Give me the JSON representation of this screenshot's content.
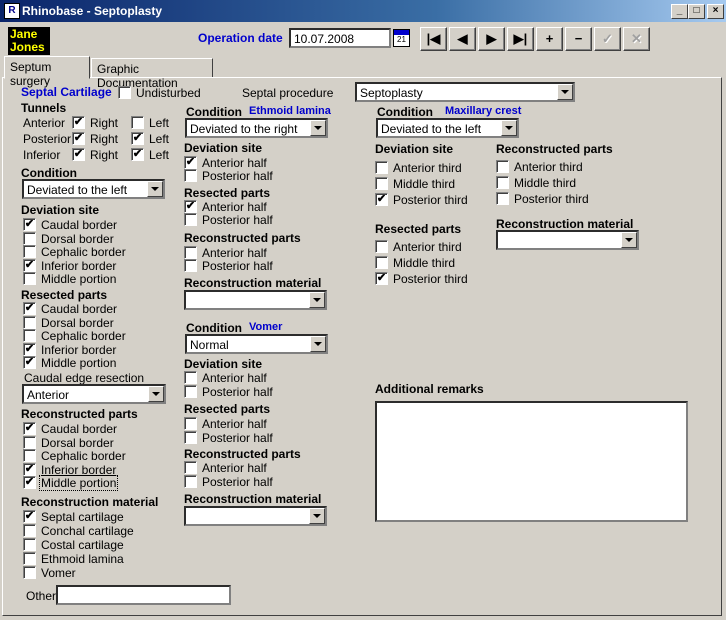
{
  "window": {
    "title": "Rhinobase - Septoplasty",
    "controls": [
      "_",
      "□",
      "×"
    ]
  },
  "patient": {
    "first": "Jane",
    "last": "Jones"
  },
  "operation": {
    "label": "Operation date",
    "date": "10.07.2008"
  },
  "tabs": [
    "Septum surgery",
    "Graphic Documentation"
  ],
  "septal": {
    "title": "Septal Cartilage",
    "undisturbed": "Undisturbed",
    "procedure_label": "Septal procedure",
    "procedure_value": "Septoplasty",
    "tunnels": {
      "title": "Tunnels",
      "rows": [
        "Anterior",
        "Posterior",
        "Inferior"
      ],
      "right": "Right",
      "left": "Left"
    },
    "condition": {
      "title": "Condition",
      "value": "Deviated to the left"
    },
    "deviation": {
      "title": "Deviation site",
      "items": [
        "Caudal border",
        "Dorsal border",
        "Cephalic border",
        "Inferior border",
        "Middle portion"
      ]
    },
    "resected": {
      "title": "Resected parts",
      "items": [
        "Caudal border",
        "Dorsal border",
        "Cephalic border",
        "Inferior border",
        "Middle portion"
      ]
    },
    "caudal_edge": {
      "title": "Caudal edge resection",
      "value": "Anterior"
    },
    "reconstructed": {
      "title": "Reconstructed parts",
      "items": [
        "Caudal border",
        "Dorsal border",
        "Cephalic border",
        "Inferior border",
        "Middle portion"
      ]
    },
    "material": {
      "title": "Reconstruction material",
      "items": [
        "Septal cartilage",
        "Conchal cartilage",
        "Costal cartilage",
        "Ethmoid lamina",
        "Vomer"
      ]
    },
    "other": "Other"
  },
  "ethmoid": {
    "condition_label": "Condition",
    "name": "Ethmoid lamina",
    "value": "Deviated to the right",
    "deviation": {
      "title": "Deviation site",
      "items": [
        "Anterior half",
        "Posterior half"
      ]
    },
    "resected": {
      "title": "Resected parts",
      "items": [
        "Anterior half",
        "Posterior half"
      ]
    },
    "reconstructed": {
      "title": "Reconstructed parts",
      "items": [
        "Anterior half",
        "Posterior half"
      ]
    },
    "material": {
      "title": "Reconstruction material",
      "value": ""
    }
  },
  "vomer": {
    "condition_label": "Condition",
    "name": "Vomer",
    "value": "Normal",
    "deviation": {
      "title": "Deviation site",
      "items": [
        "Anterior half",
        "Posterior half"
      ]
    },
    "resected": {
      "title": "Resected parts",
      "items": [
        "Anterior half",
        "Posterior half"
      ]
    },
    "reconstructed": {
      "title": "Reconstructed parts",
      "items": [
        "Anterior half",
        "Posterior half"
      ]
    },
    "material": {
      "title": "Reconstruction material",
      "value": ""
    }
  },
  "maxillary": {
    "condition_label": "Condition",
    "name": "Maxillary crest",
    "value": "Deviated to the left",
    "deviation": {
      "title": "Deviation site",
      "items": [
        "Anterior third",
        "Middle third",
        "Posterior third"
      ]
    },
    "resected": {
      "title": "Resected parts",
      "items": [
        "Anterior third",
        "Middle third",
        "Posterior third"
      ]
    },
    "reconstructed": {
      "title": "Reconstructed parts",
      "items": [
        "Anterior third",
        "Middle third",
        "Posterior third"
      ]
    },
    "material": {
      "title": "Reconstruction material",
      "value": ""
    }
  },
  "remarks": {
    "title": "Additional remarks",
    "value": ""
  },
  "colors": {
    "title_bar": "#0a246a",
    "link_blue": "#0000cc",
    "patient_bg": "#000000",
    "patient_fg": "#ffff00"
  }
}
